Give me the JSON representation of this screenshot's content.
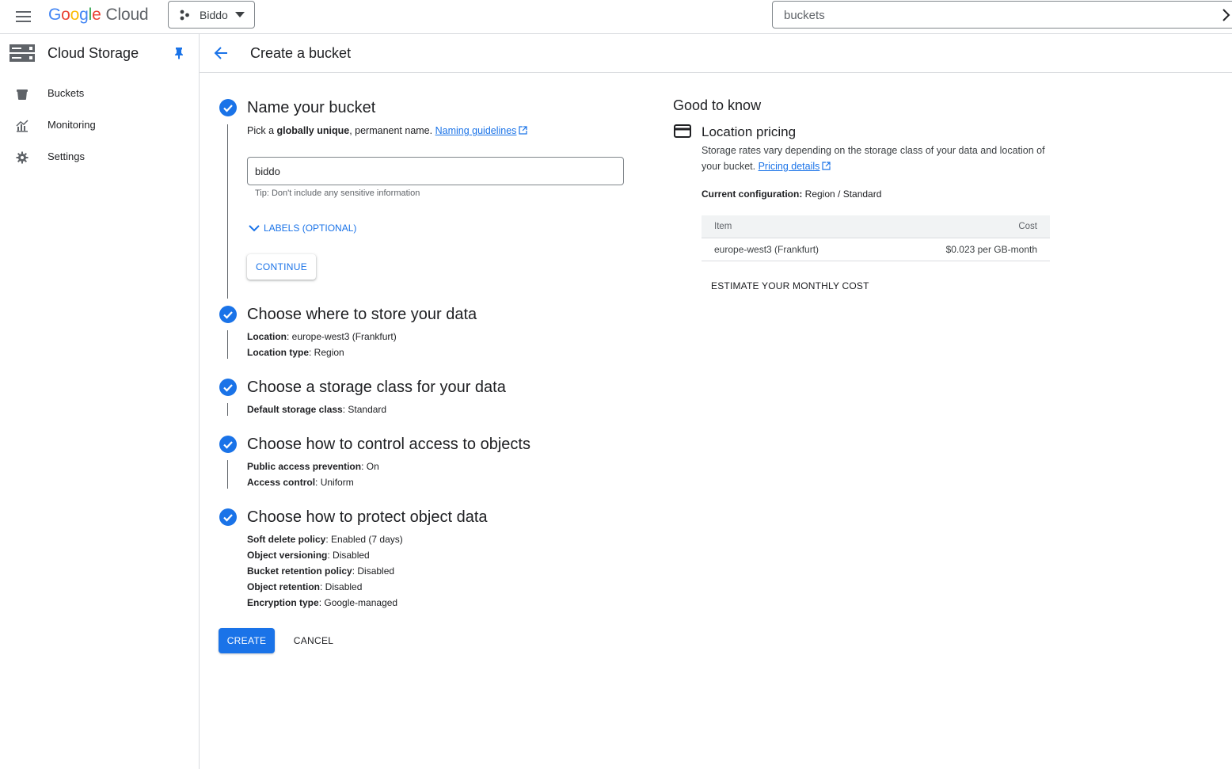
{
  "colors": {
    "accent": "#1a73e8",
    "text": "#202124",
    "muted": "#5f6368",
    "border": "#dadce0"
  },
  "topbar": {
    "logo_google": "Google",
    "logo_cloud": "Cloud",
    "project_name": "Biddo",
    "search_value": "buckets"
  },
  "sidebar": {
    "title": "Cloud Storage",
    "items": [
      {
        "label": "Buckets",
        "icon": "bucket-icon"
      },
      {
        "label": "Monitoring",
        "icon": "monitoring-chart-icon"
      },
      {
        "label": "Settings",
        "icon": "gear-icon"
      }
    ]
  },
  "main": {
    "title": "Create a bucket",
    "steps": [
      {
        "title": "Name your bucket",
        "intro_pre": "Pick a ",
        "intro_bold": "globally unique",
        "intro_post": ", permanent name.",
        "link": "Naming guidelines",
        "input_value": "biddo",
        "tip": "Tip: Don't include any sensitive information",
        "labels_toggle": "LABELS (OPTIONAL)",
        "continue": "CONTINUE"
      },
      {
        "title": "Choose where to store your data",
        "details": [
          {
            "label": "Location",
            "value": ": europe-west3 (Frankfurt)"
          },
          {
            "label": "Location type",
            "value": ": Region"
          }
        ]
      },
      {
        "title": "Choose a storage class for your data",
        "details": [
          {
            "label": "Default storage class",
            "value": ": Standard"
          }
        ]
      },
      {
        "title": "Choose how to control access to objects",
        "details": [
          {
            "label": "Public access prevention",
            "value": ": On"
          },
          {
            "label": "Access control",
            "value": ": Uniform"
          }
        ]
      },
      {
        "title": "Choose how to protect object data",
        "details": [
          {
            "label": "Soft delete policy",
            "value": ": Enabled (7 days)"
          },
          {
            "label": "Object versioning",
            "value": ": Disabled"
          },
          {
            "label": "Bucket retention policy",
            "value": ": Disabled"
          },
          {
            "label": "Object retention",
            "value": ": Disabled"
          },
          {
            "label": "Encryption type",
            "value": ": Google-managed"
          }
        ]
      }
    ],
    "create": "CREATE",
    "cancel": "CANCEL"
  },
  "right_panel": {
    "heading": "Good to know",
    "pricing_title": "Location pricing",
    "pricing_desc": "Storage rates vary depending on the storage class of your data and location of your bucket.",
    "pricing_link": "Pricing details",
    "config_label": "Current configuration:",
    "config_value": " Region / Standard",
    "table": {
      "headers": [
        "Item",
        "Cost"
      ],
      "rows": [
        [
          "europe-west3 (Frankfurt)",
          "$0.023 per GB-month"
        ]
      ]
    },
    "estimate": "ESTIMATE YOUR MONTHLY COST"
  }
}
